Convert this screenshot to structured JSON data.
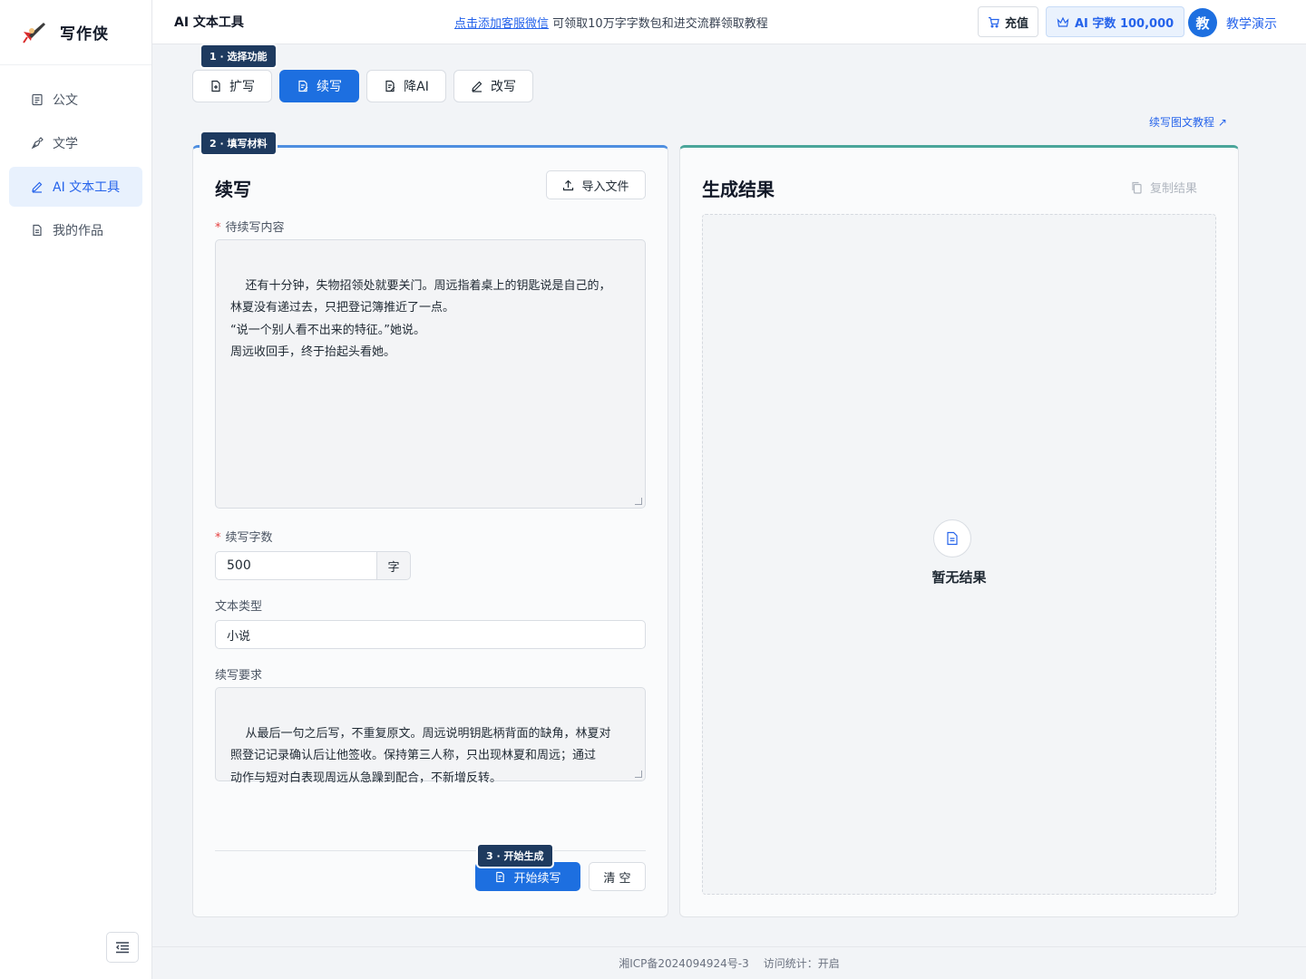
{
  "app": {
    "name": "写作侠"
  },
  "sidebar": {
    "items": [
      {
        "label": "公文",
        "icon": "document-list-icon"
      },
      {
        "label": "文学",
        "icon": "pen-nib-icon"
      },
      {
        "label": "AI 文本工具",
        "icon": "pencil-icon",
        "active": true
      },
      {
        "label": "我的作品",
        "icon": "file-icon"
      }
    ]
  },
  "header": {
    "title": "AI 文本工具",
    "notice_link": "点击添加客服微信",
    "notice_text": "可领取10万字字数包和进交流群领取教程",
    "recharge_label": "充值",
    "quota_label": "AI 字数 100,000",
    "avatar_char": "教",
    "user_name": "教学演示"
  },
  "steps": {
    "step1": "1 · 选择功能",
    "step2": "2 · 填写材料",
    "step3": "3 · 开始生成"
  },
  "tabs": [
    {
      "label": "扩写"
    },
    {
      "label": "续写",
      "active": true
    },
    {
      "label": "降AI"
    },
    {
      "label": "改写"
    }
  ],
  "tutorial_link": "续写图文教程 ↗",
  "form": {
    "title": "续写",
    "import_label": "导入文件",
    "content_label": "待续写内容",
    "content_value": "还有十分钟，失物招领处就要关门。周远指着桌上的钥匙说是自己的，\n林夏没有递过去，只把登记簿推近了一点。\n“说一个别人看不出来的特征。”她说。\n周远收回手，终于抬起头看她。",
    "count_label": "续写字数",
    "count_value": "500",
    "count_unit": "字",
    "type_label": "文本类型",
    "type_value": "小说",
    "requirement_label": "续写要求",
    "requirement_value": "从最后一句之后写，不重复原文。周远说明钥匙柄背面的缺角，林夏对\n照登记记录确认后让他签收。保持第三人称，只出现林夏和周远；通过\n动作与短对白表现周远从急躁到配合，不新增反转。",
    "start_label": "开始续写",
    "clear_label": "清 空"
  },
  "result": {
    "title": "生成结果",
    "copy_label": "复制结果",
    "empty_text": "暂无结果"
  },
  "footer": {
    "icp": "湘ICP备2024094924号-3",
    "stats": "访问统计：开启"
  },
  "colors": {
    "primary": "#1d6fe0",
    "left_panel_accent": "#4e8ee0",
    "right_panel_accent": "#4aa59a",
    "badge_bg": "#1e3a5f"
  }
}
